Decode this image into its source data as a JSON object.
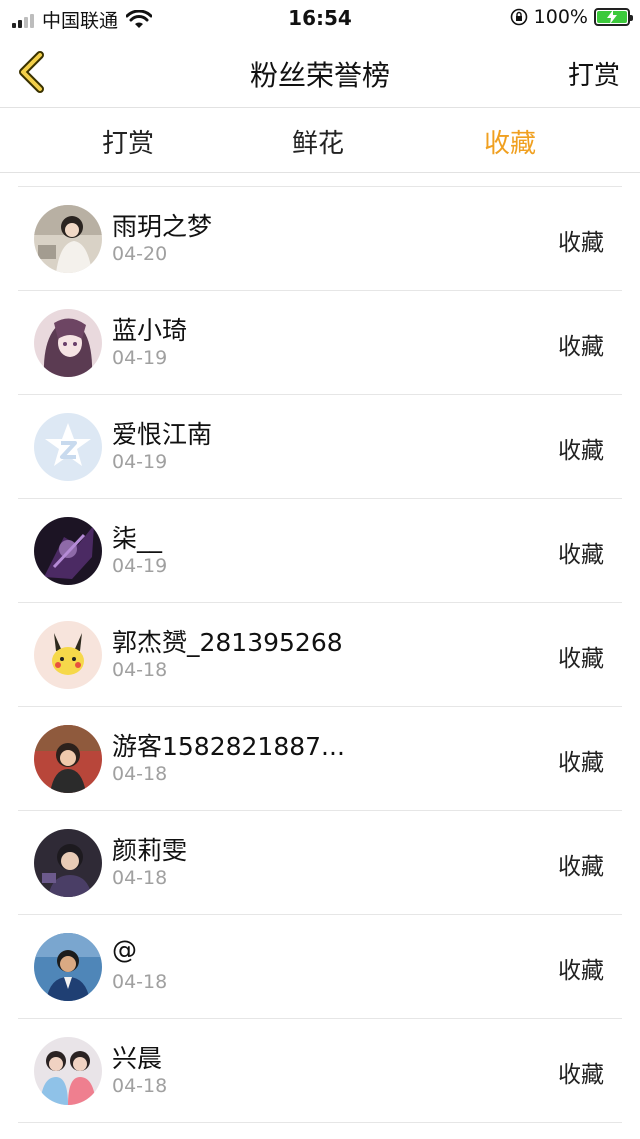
{
  "status_bar": {
    "carrier": "中国联通",
    "time": "16:54",
    "battery": "100%"
  },
  "nav": {
    "title": "粉丝荣誉榜",
    "right_label": "打赏"
  },
  "tabs": [
    {
      "label": "打赏",
      "active": false
    },
    {
      "label": "鲜花",
      "active": false
    },
    {
      "label": "收藏",
      "active": true
    }
  ],
  "accent_color": "#f0a020",
  "list": [
    {
      "name": "雨玥之梦",
      "date": "04-20",
      "action": "收藏",
      "avatar": "photo-avatar"
    },
    {
      "name": "蓝小琦",
      "date": "04-19",
      "action": "收藏",
      "avatar": "anime-avatar"
    },
    {
      "name": "爱恨江南",
      "date": "04-19",
      "action": "收藏",
      "avatar": "default-qq-avatar"
    },
    {
      "name": "柒__",
      "date": "04-19",
      "action": "收藏",
      "avatar": "dark-art-avatar"
    },
    {
      "name": "郭杰赟_281395268",
      "date": "04-18",
      "action": "收藏",
      "avatar": "pikachu-avatar"
    },
    {
      "name": "游客1582821887...",
      "date": "04-18",
      "action": "收藏",
      "avatar": "photo-avatar"
    },
    {
      "name": "颜莉雯",
      "date": "04-18",
      "action": "收藏",
      "avatar": "photo-avatar"
    },
    {
      "name": "@",
      "date": "04-18",
      "action": "收藏",
      "avatar": "photo-avatar"
    },
    {
      "name": "兴晨",
      "date": "04-18",
      "action": "收藏",
      "avatar": "photo-avatar"
    }
  ]
}
